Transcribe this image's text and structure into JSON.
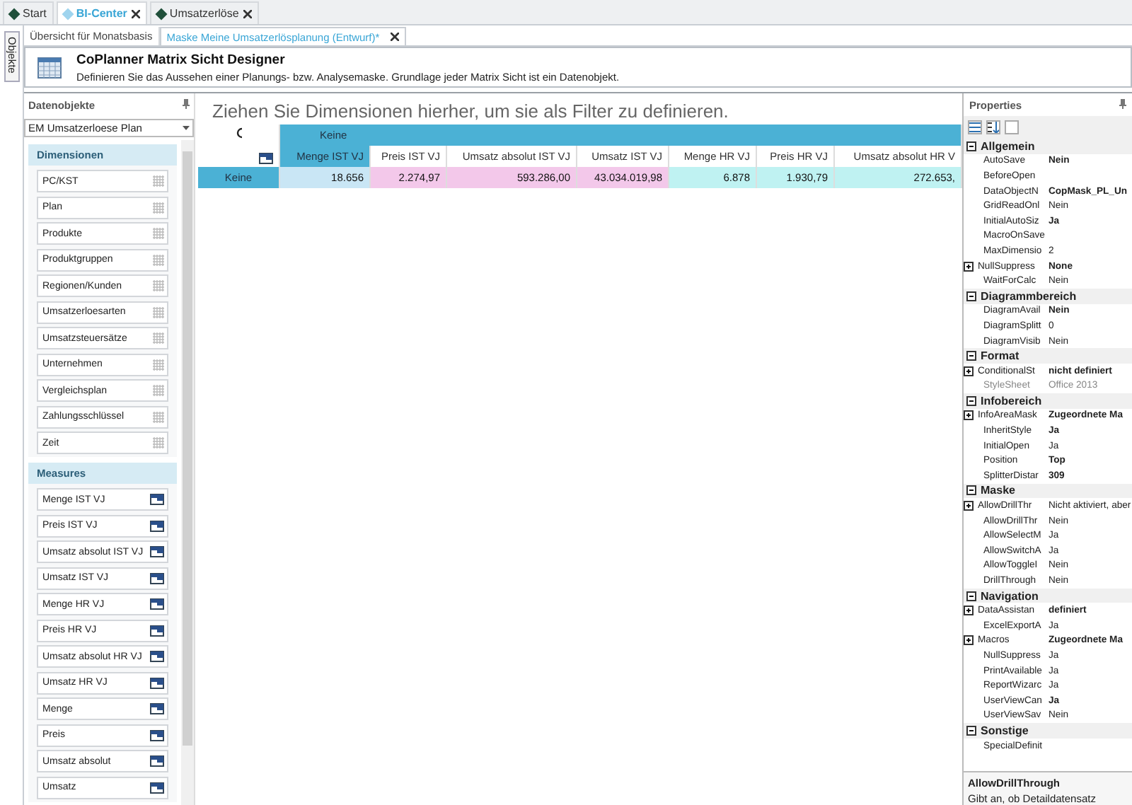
{
  "top_tabs": [
    {
      "label": "Start",
      "selected": false,
      "closable": false
    },
    {
      "label": "BI-Center",
      "selected": true,
      "closable": true
    },
    {
      "label": "Umsatzerlöse",
      "selected": false,
      "closable": true
    }
  ],
  "side_strip": {
    "label": "Objekte"
  },
  "doc_tabs": [
    {
      "label": "Übersicht für Monatsbasis",
      "selected": false,
      "closable": false
    },
    {
      "label": "Maske Meine Umsatzerlösplanung (Entwurf)*",
      "selected": true,
      "closable": true
    }
  ],
  "header": {
    "title": "CoPlanner Matrix Sicht Designer",
    "description": "Definieren Sie das Aussehen einer Planungs- bzw. Analysemaske. Grundlage jeder Matrix Sicht ist ein Datenobjekt."
  },
  "data_objects": {
    "title": "Datenobjekte",
    "dropdown": "EM Umsatzerloese Plan",
    "groups": [
      {
        "title": "Dimensionen",
        "kind": "dimension",
        "items": [
          "PC/KST",
          "Plan",
          "Produkte",
          "Produktgruppen",
          "Regionen/Kunden",
          "Umsatzerloesarten",
          "Umsatzsteuersätze",
          "Unternehmen",
          "Vergleichsplan",
          "Zahlungsschlüssel",
          "Zeit"
        ]
      },
      {
        "title": "Measures",
        "kind": "measure",
        "items": [
          "Menge IST VJ",
          "Preis IST VJ",
          "Umsatz absolut IST VJ",
          "Umsatz IST VJ",
          "Menge HR VJ",
          "Preis HR VJ",
          "Umsatz absolut HR VJ",
          "Umsatz HR VJ",
          "Menge",
          "Preis",
          "Umsatz absolut",
          "Umsatz"
        ]
      }
    ]
  },
  "filter_hint": "Ziehen Sie Dimensionen hierher, um sie als Filter zu definieren.",
  "matrix": {
    "column_dimension": "Keine",
    "row_label": "Keine",
    "columns": [
      {
        "label": "Menge IST VJ",
        "value": "18.656",
        "selected": true,
        "color": "#c9e6f5"
      },
      {
        "label": "Preis IST VJ",
        "value": "2.274,97",
        "selected": false,
        "color": "#f3c8ea"
      },
      {
        "label": "Umsatz absolut IST VJ",
        "value": "593.286,00",
        "selected": false,
        "color": "#f3c8ea"
      },
      {
        "label": "Umsatz IST VJ",
        "value": "43.034.019,98",
        "selected": false,
        "color": "#f3c8ea"
      },
      {
        "label": "Menge HR VJ",
        "value": "6.878",
        "selected": false,
        "color": "#bff2f2"
      },
      {
        "label": "Preis HR VJ",
        "value": "1.930,79",
        "selected": false,
        "color": "#bff2f2"
      },
      {
        "label": "Umsatz absolut HR V",
        "value": "272.653,",
        "selected": false,
        "color": "#bff2f2"
      }
    ]
  },
  "properties": {
    "title": "Properties",
    "categories": [
      {
        "title": "Allgemein",
        "expanded": true,
        "items": [
          {
            "name": "AutoSave",
            "value": "Nein",
            "bold": true,
            "expandable": false,
            "disabled": false
          },
          {
            "name": "BeforeOpen",
            "value": "",
            "bold": false,
            "expandable": false,
            "disabled": false
          },
          {
            "name": "DataObjectN",
            "value": "CopMask_PL_Un",
            "bold": true,
            "expandable": false,
            "disabled": false
          },
          {
            "name": "GridReadOnl",
            "value": "Nein",
            "bold": false,
            "expandable": false,
            "disabled": false
          },
          {
            "name": "InitialAutoSiz",
            "value": "Ja",
            "bold": true,
            "expandable": false,
            "disabled": false
          },
          {
            "name": "MacroOnSave",
            "value": "",
            "bold": false,
            "expandable": false,
            "disabled": false
          },
          {
            "name": "MaxDimensio",
            "value": "2",
            "bold": false,
            "expandable": false,
            "disabled": false
          },
          {
            "name": "NullSuppress",
            "value": "None",
            "bold": true,
            "expandable": true,
            "disabled": false
          },
          {
            "name": "WaitForCalc",
            "value": "Nein",
            "bold": false,
            "expandable": false,
            "disabled": false
          }
        ]
      },
      {
        "title": "Diagrammbereich",
        "expanded": true,
        "items": [
          {
            "name": "DiagramAvail",
            "value": "Nein",
            "bold": true,
            "expandable": false,
            "disabled": false
          },
          {
            "name": "DiagramSplitt",
            "value": "0",
            "bold": false,
            "expandable": false,
            "disabled": false
          },
          {
            "name": "DiagramVisib",
            "value": "Nein",
            "bold": false,
            "expandable": false,
            "disabled": false
          }
        ]
      },
      {
        "title": "Format",
        "expanded": true,
        "items": [
          {
            "name": "ConditionalSt",
            "value": "nicht definiert",
            "bold": true,
            "expandable": true,
            "disabled": false
          },
          {
            "name": "StyleSheet",
            "value": "Office 2013",
            "bold": false,
            "expandable": false,
            "disabled": true
          }
        ]
      },
      {
        "title": "Infobereich",
        "expanded": true,
        "items": [
          {
            "name": "InfoAreaMask",
            "value": "Zugeordnete Ma",
            "bold": true,
            "expandable": true,
            "disabled": false
          },
          {
            "name": "InheritStyle",
            "value": "Ja",
            "bold": true,
            "expandable": false,
            "disabled": false
          },
          {
            "name": "InitialOpen",
            "value": "Ja",
            "bold": false,
            "expandable": false,
            "disabled": false
          },
          {
            "name": "Position",
            "value": "Top",
            "bold": true,
            "expandable": false,
            "disabled": false
          },
          {
            "name": "SplitterDistar",
            "value": "309",
            "bold": true,
            "expandable": false,
            "disabled": false
          }
        ]
      },
      {
        "title": "Maske",
        "expanded": true,
        "items": [
          {
            "name": "AllowDrillThr",
            "value": "Nicht aktiviert, aber",
            "bold": false,
            "expandable": true,
            "disabled": false
          },
          {
            "name": "AllowDrillThr",
            "value": "Nein",
            "bold": false,
            "expandable": false,
            "disabled": false
          },
          {
            "name": "AllowSelectM",
            "value": "Ja",
            "bold": false,
            "expandable": false,
            "disabled": false
          },
          {
            "name": "AllowSwitchA",
            "value": "Ja",
            "bold": false,
            "expandable": false,
            "disabled": false
          },
          {
            "name": "AllowToggleI",
            "value": "Nein",
            "bold": false,
            "expandable": false,
            "disabled": false
          },
          {
            "name": "DrillThrough",
            "value": "Nein",
            "bold": false,
            "expandable": false,
            "disabled": false
          }
        ]
      },
      {
        "title": "Navigation",
        "expanded": true,
        "items": [
          {
            "name": "DataAssistan",
            "value": "definiert",
            "bold": true,
            "expandable": true,
            "disabled": false
          },
          {
            "name": "ExcelExportA",
            "value": "Ja",
            "bold": false,
            "expandable": false,
            "disabled": false
          },
          {
            "name": "Macros",
            "value": "Zugeordnete Ma",
            "bold": true,
            "expandable": true,
            "disabled": false
          },
          {
            "name": "NullSuppress",
            "value": "Ja",
            "bold": false,
            "expandable": false,
            "disabled": false
          },
          {
            "name": "PrintAvailable",
            "value": "Ja",
            "bold": false,
            "expandable": false,
            "disabled": false
          },
          {
            "name": "ReportWizarc",
            "value": "Ja",
            "bold": false,
            "expandable": false,
            "disabled": false
          },
          {
            "name": "UserViewCan",
            "value": "Ja",
            "bold": true,
            "expandable": false,
            "disabled": false
          },
          {
            "name": "UserViewSav",
            "value": "Nein",
            "bold": false,
            "expandable": false,
            "disabled": false
          }
        ]
      },
      {
        "title": "Sonstige",
        "expanded": true,
        "items": [
          {
            "name": "SpecialDefinit",
            "value": "",
            "bold": false,
            "expandable": false,
            "disabled": false
          }
        ]
      }
    ],
    "help_title": "AllowDrillThrough",
    "help_text": "Gibt an, ob Detaildatensatz"
  }
}
